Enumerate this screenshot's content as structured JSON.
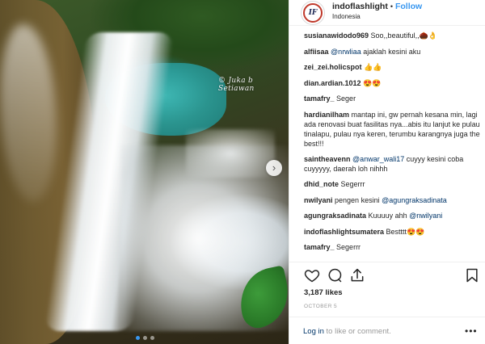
{
  "photo": {
    "watermark": "© Juka b Setiawan",
    "next_icon": "chevron-right-icon",
    "carousel_index": 1,
    "carousel_total": 3
  },
  "post": {
    "username": "indoflashlight",
    "separator": "•",
    "follow_label": "Follow",
    "location": "Indonesia",
    "avatar_mark": "IF"
  },
  "comments": [
    {
      "user": "susianawidodo969",
      "text": "Soo,,beautiful,,🌰👌"
    },
    {
      "user": "alfiisaa",
      "mention": "@nrwliaa",
      "text": " ajaklah kesini aku"
    },
    {
      "user": "zei_zei.holicspot",
      "text": "👍👍"
    },
    {
      "user": "dian.ardian.1012",
      "text": "😍😍"
    },
    {
      "user": "tamafry_",
      "text": "Seger"
    },
    {
      "user": "hardianilham",
      "text": "mantap ini, gw pernah kesana min, lagi ada renovasi buat fasilitas nya...abis itu lanjut ke pulau tinalapu, pulau nya keren, terumbu karangnya juga the best!!!"
    },
    {
      "user": "saintheavenn",
      "mention": "@anwar_wali17",
      "text": " cuyyy kesini coba cuyyyyy, daerah loh nihhh"
    },
    {
      "user": "dhid_note",
      "text": "Segerrr"
    },
    {
      "user": "nwilyani",
      "text": "pengen kesini ",
      "mention_after": "@agungraksadinata"
    },
    {
      "user": "agungraksadinata",
      "text": "Kuuuuy ahh ",
      "mention_after": "@nwilyani"
    },
    {
      "user": "indoflashlightsumatera",
      "text": "Bestttt😍😍"
    },
    {
      "user": "tamafry_",
      "text": "Segerrr"
    }
  ],
  "actions": {
    "like_icon": "heart-icon",
    "comment_icon": "comment-icon",
    "share_icon": "share-icon",
    "save_icon": "bookmark-icon"
  },
  "likes": "3,187 likes",
  "date": "OCTOBER 5",
  "footer": {
    "login": "Log in",
    "rest": " to like or comment.",
    "more": "•••"
  },
  "colors": {
    "link": "#003569",
    "accent": "#3897f0",
    "muted": "#999999"
  }
}
